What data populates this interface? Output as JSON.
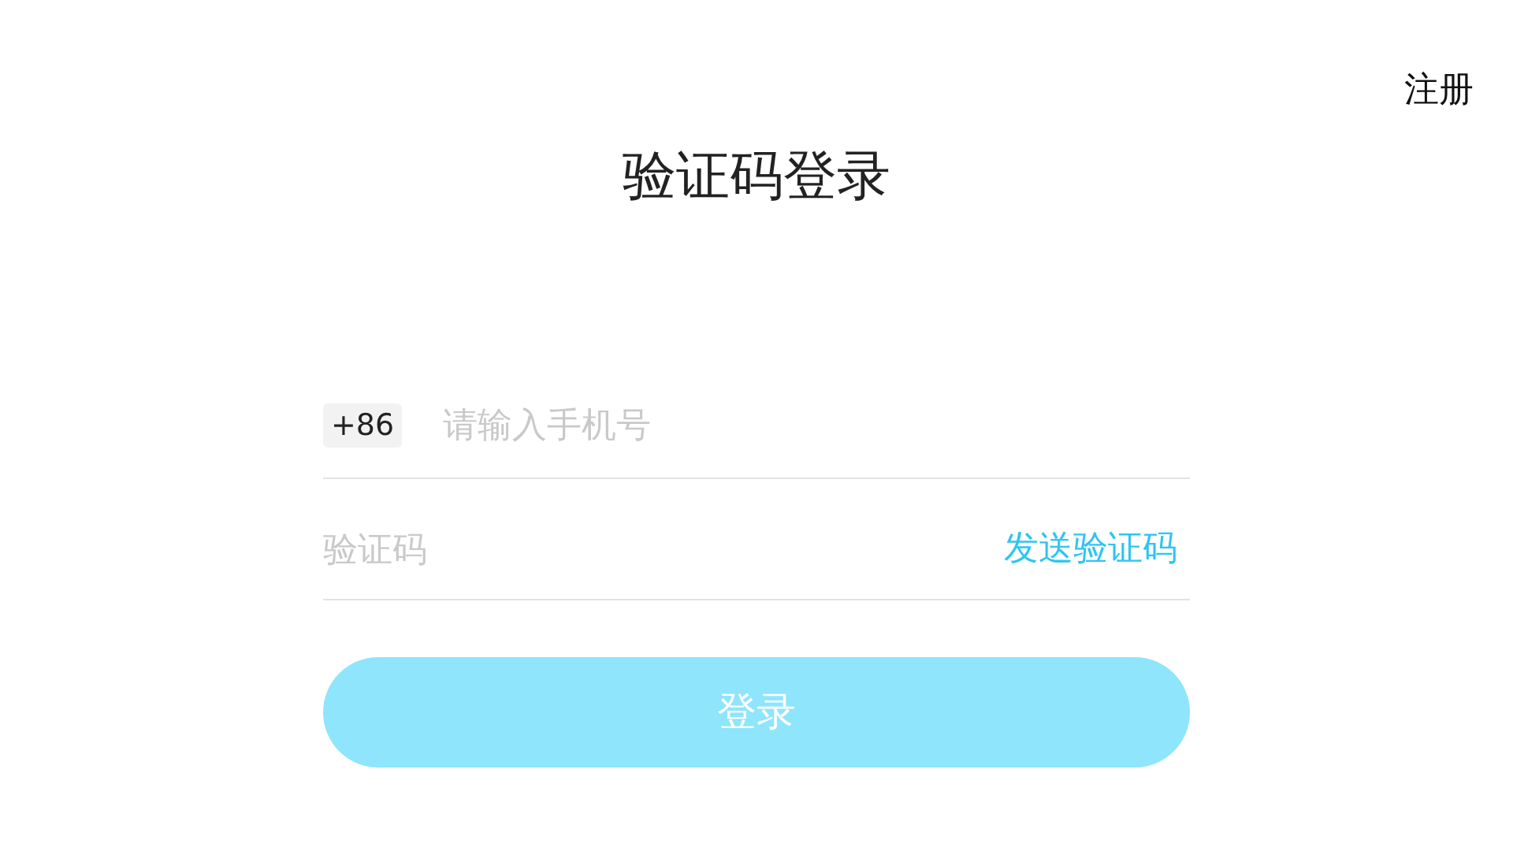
{
  "register_link": "注册",
  "title": "验证码登录",
  "phone_field": {
    "country_code": "+86",
    "placeholder": "请输入手机号"
  },
  "code_field": {
    "placeholder": "验证码",
    "send_code_link": "发送验证码"
  },
  "login_button": {
    "label": "登录",
    "disabled": true
  }
}
